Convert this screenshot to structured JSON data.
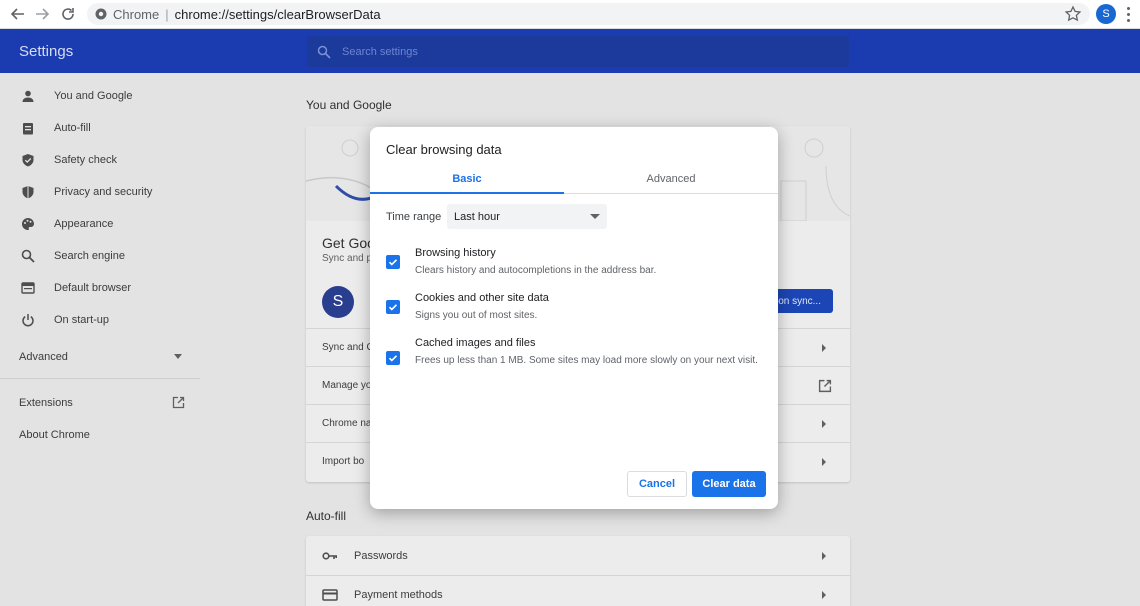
{
  "browser": {
    "site_label": "Chrome",
    "separator": "|",
    "url_path": "chrome://settings/clearBrowserData",
    "profile_initial": "S"
  },
  "header": {
    "title": "Settings",
    "search_placeholder": "Search settings"
  },
  "sidebar": {
    "items": [
      {
        "label": "You and Google",
        "icon": "person-icon"
      },
      {
        "label": "Auto-fill",
        "icon": "clipboard-icon"
      },
      {
        "label": "Safety check",
        "icon": "shield-check-icon"
      },
      {
        "label": "Privacy and security",
        "icon": "shield-icon"
      },
      {
        "label": "Appearance",
        "icon": "palette-icon"
      },
      {
        "label": "Search engine",
        "icon": "search-icon"
      },
      {
        "label": "Default browser",
        "icon": "browser-icon"
      },
      {
        "label": "On start-up",
        "icon": "power-icon"
      }
    ],
    "advanced_label": "Advanced",
    "extensions_label": "Extensions",
    "about_label": "About Chrome"
  },
  "main": {
    "you_and_google_title": "You and Google",
    "get_title": "Get Goo",
    "get_sub": "Sync and p",
    "avatar_initial": "S",
    "sync_button": "on sync...",
    "rows": [
      "Sync and G",
      "Manage yo",
      "Chrome na",
      "Import bo"
    ],
    "autofill_title": "Auto-fill",
    "autofill_rows": [
      {
        "label": "Passwords",
        "icon": "key-icon"
      },
      {
        "label": "Payment methods",
        "icon": "credit-card-icon"
      }
    ]
  },
  "dialog": {
    "title": "Clear browsing data",
    "tabs": [
      {
        "label": "Basic",
        "active": true
      },
      {
        "label": "Advanced",
        "active": false
      }
    ],
    "time_range_label": "Time range",
    "time_range_value": "Last hour",
    "options": [
      {
        "title": "Browsing history",
        "desc": "Clears history and autocompletions in the address bar.",
        "checked": true
      },
      {
        "title": "Cookies and other site data",
        "desc": "Signs you out of most sites.",
        "checked": true
      },
      {
        "title": "Cached images and files",
        "desc": "Frees up less than 1 MB. Some sites may load more slowly on your next visit.",
        "checked": true
      }
    ],
    "cancel_label": "Cancel",
    "clear_label": "Clear data"
  },
  "colors": {
    "accent": "#1a73e8",
    "header": "#1a3cb0"
  }
}
